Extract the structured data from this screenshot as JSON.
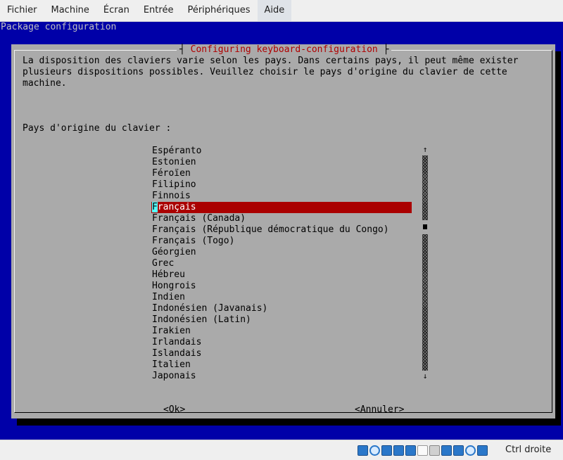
{
  "menubar": {
    "items": [
      "Fichier",
      "Machine",
      "Écran",
      "Entrée",
      "Périphériques",
      "Aide"
    ]
  },
  "screen": {
    "header": "Package configuration"
  },
  "dialog": {
    "title": "Configuring keyboard-configuration",
    "intro": "La disposition des claviers varie selon les pays. Dans certains pays, il peut même exister\nplusieurs dispositions possibles. Veuillez choisir le pays d'origine du clavier de cette\nmachine.",
    "prompt": "Pays d'origine du clavier :",
    "options": [
      "Espéranto",
      "Estonien",
      "Féroïen",
      "Filipino",
      "Finnois",
      "Français",
      "Français (Canada)",
      "Français (République démocratique du Congo)",
      "Français (Togo)",
      "Géorgien",
      "Grec",
      "Hébreu",
      "Hongrois",
      "Indien",
      "Indonésien (Javanais)",
      "Indonésien (Latin)",
      "Irakien",
      "Irlandais",
      "Islandais",
      "Italien",
      "Japonais"
    ],
    "selected_index": 5,
    "selected_first_char": "F",
    "selected_rest": "rançais",
    "ok_label": "<Ok>",
    "cancel_label": "<Annuler>",
    "scroll_up_glyph": "↑",
    "scroll_down_glyph": "↓"
  },
  "statusbar": {
    "host_key": "Ctrl droite",
    "icons": [
      "hdd-icon",
      "optical-drive-icon",
      "audio-icon",
      "network-icon",
      "usb-icon",
      "shared-folders-icon",
      "display-icon",
      "video-capture-icon",
      "recording-icon",
      "mouse-integration-icon",
      "host-key-icon"
    ]
  },
  "colors": {
    "screen_bg": "#0000a8",
    "dialog_bg": "#aaaaaa",
    "selection_bg": "#aa0000",
    "title_fg": "#b00000"
  }
}
